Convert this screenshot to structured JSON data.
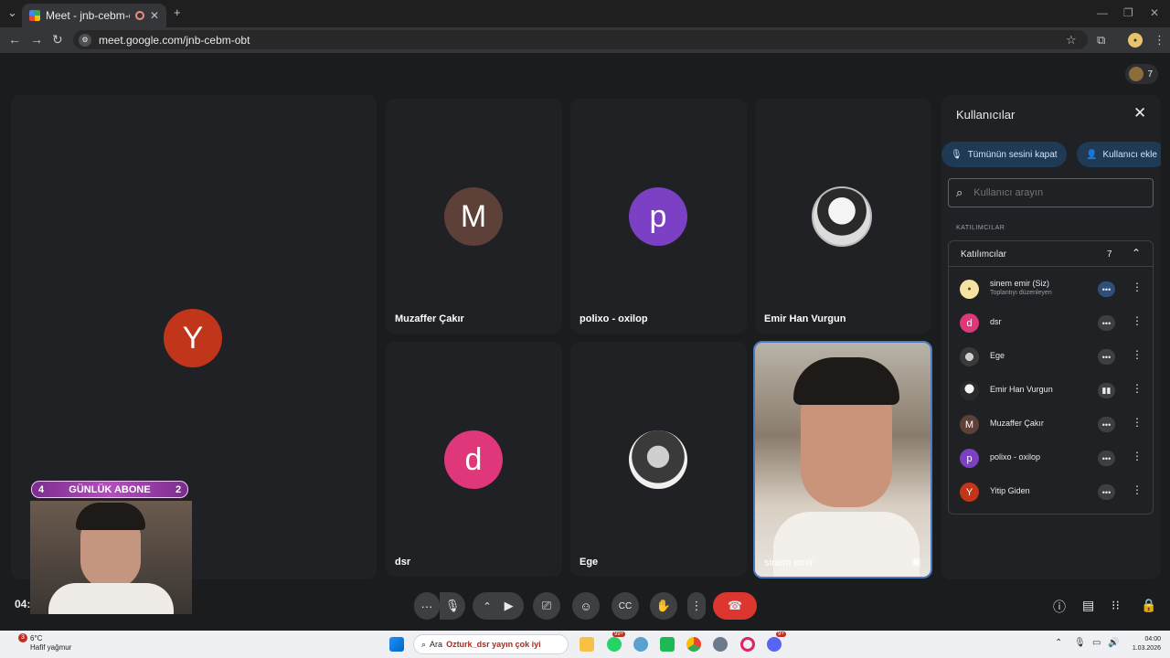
{
  "browser": {
    "tab_title": "Meet - jnb-cebm-obt",
    "url": "meet.google.com/jnb-cebm-obt"
  },
  "meet": {
    "participant_count": "7",
    "tiles": [
      {
        "id": "y",
        "letter": "Y",
        "color": "#c1361b"
      },
      {
        "id": "muzaffer",
        "letter": "M",
        "color": "#5d4037",
        "name": "Muzaffer Çakır"
      },
      {
        "id": "polixo",
        "letter": "p",
        "color": "#7b40c4",
        "name": "polixo - oxilop"
      },
      {
        "id": "emirhan",
        "name": "Emir Han Vurgun"
      },
      {
        "id": "dsr",
        "letter": "d",
        "color": "#e0367a",
        "name": "dsr"
      },
      {
        "id": "ege",
        "name": "Ege"
      },
      {
        "id": "sinem",
        "name": "sinem emir"
      }
    ],
    "clock": "04:",
    "overlay": {
      "left_number": "4",
      "title": "GÜNLÜK ABONE",
      "right_number": "2"
    }
  },
  "panel": {
    "title": "Kullanıcılar",
    "mute_all_label": "Tümünün sesini kapat",
    "add_user_label": "Kullanıcı ekle",
    "search_placeholder": "Kullanıcı arayın",
    "section_label": "KATILIMCILAR",
    "group_label": "Katılımcılar",
    "group_count": "7",
    "participants": [
      {
        "name": "sinem emir (Siz)",
        "subtitle": "Toplantıyı düzenleyen",
        "avatar": "img",
        "color": "#f4e3a1",
        "status": "more"
      },
      {
        "name": "dsr",
        "avatar": "d",
        "color": "#e0367a",
        "status": "more"
      },
      {
        "name": "Ege",
        "avatar": "img",
        "color": "#9e9e9e",
        "status": "more"
      },
      {
        "name": "Emir Han Vurgun",
        "avatar": "img",
        "color": "#d9d9d9",
        "status": "speaking"
      },
      {
        "name": "Muzaffer Çakır",
        "avatar": "M",
        "color": "#5d4037",
        "status": "more"
      },
      {
        "name": "polixo - oxilop",
        "avatar": "p",
        "color": "#7b40c4",
        "status": "more"
      },
      {
        "name": "Yitip Giden",
        "avatar": "Y",
        "color": "#c1361b",
        "status": "more"
      }
    ]
  },
  "taskbar": {
    "weather_temp": "6°C",
    "weather_desc": "Hafif yağmur",
    "weather_badge": "3",
    "search_text": "Ara",
    "search_extra": "Ozturk_dsr yayın çok iyi",
    "time": "04:00",
    "date": "1.03.2026",
    "whatsapp_badge": "99+",
    "discord_badge": "9+"
  }
}
